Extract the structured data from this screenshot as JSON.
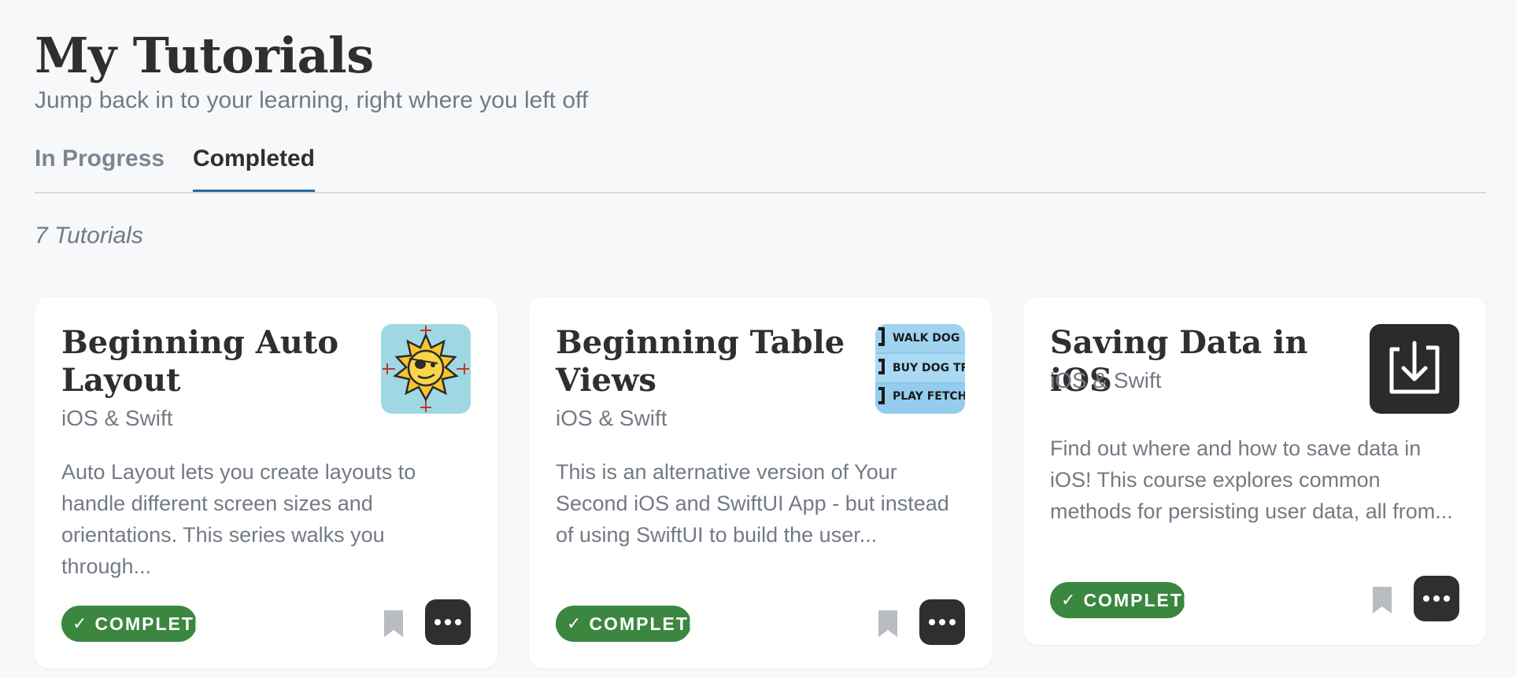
{
  "header": {
    "title": "My Tutorials",
    "subtitle": "Jump back in to your learning, right where you left off"
  },
  "tabs": [
    {
      "label": "In Progress",
      "active": false
    },
    {
      "label": "Completed",
      "active": true
    }
  ],
  "tutorial_count": "7 Tutorials",
  "colors": {
    "accent_tab_underline": "#2a6b9a",
    "complete_badge": "#3b8740",
    "more_button": "#2f2f2f",
    "bookmark_icon": "#b9bcc1"
  },
  "cards": [
    {
      "title": "Beginning Auto Layout",
      "category": "iOS & Swift",
      "description": "Auto Layout lets you create layouts to handle different screen sizes and orientations. This series walks you through...",
      "badge": "COMPLETE",
      "thumbnail_icon": "pirate-sun-icon"
    },
    {
      "title": "Beginning Table Views",
      "category": "iOS & Swift",
      "description": "This is an alternative version of Your Second iOS and SwiftUI App - but instead of using SwiftUI to build the user...",
      "badge": "COMPLETE",
      "thumbnail_icon": "todo-list-icon",
      "thumbnail_lines": [
        "WALK DOG",
        "BUY DOG TREA",
        "PLAY FETCH"
      ]
    },
    {
      "title": "Saving Data in iOS",
      "category": "iOS & Swift",
      "description": "Find out where and how to save data in iOS! This course explores common methods for persisting user data, all from...",
      "badge": "COMPLETE",
      "thumbnail_icon": "save-download-icon"
    }
  ]
}
